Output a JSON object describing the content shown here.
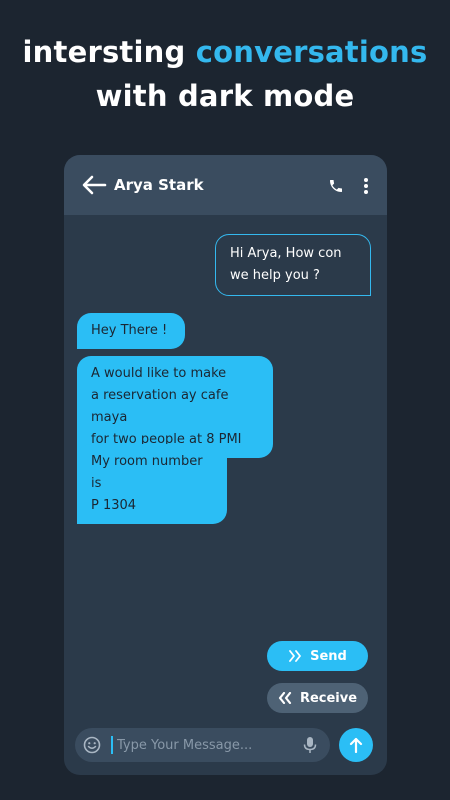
{
  "headline": {
    "line1_prefix": "intersting",
    "line1_accent": "conversations",
    "line2": "with dark mode"
  },
  "appbar": {
    "contact_name": "Arya Stark",
    "icons": {
      "back": "arrow-left-icon",
      "call": "phone-icon",
      "more": "more-vertical-icon"
    }
  },
  "messages": [
    {
      "direction": "outgoing",
      "lines": [
        "Hi Arya, How con",
        "we help you ?"
      ]
    },
    {
      "direction": "incoming",
      "lines": [
        "Hey There !"
      ]
    },
    {
      "direction": "incoming",
      "lines": [
        "A would like to make",
        "a reservation ay cafe maya",
        "for two people at 8 PMI"
      ]
    },
    {
      "direction": "incoming",
      "lines": [
        "My room number is",
        "P 1304"
      ]
    }
  ],
  "actions": {
    "send_label": "Send",
    "receive_label": "Receive"
  },
  "composer": {
    "placeholder": "Type Your Message...",
    "value": ""
  },
  "colors": {
    "background": "#1c2530",
    "accent": "#34b8ee",
    "bubble_incoming": "#2bbef5",
    "appbar": "#3a4c5f",
    "chat_bg": "#2b3a4a"
  }
}
